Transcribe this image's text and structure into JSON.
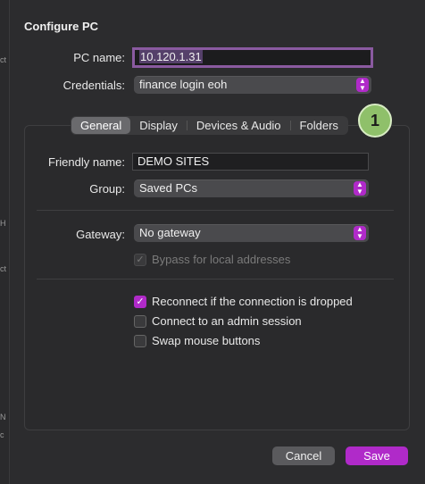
{
  "background": {
    "fragments": [
      "ct",
      "H",
      "ct",
      "N",
      "c"
    ]
  },
  "dialog": {
    "title": "Configure PC",
    "pc_name": {
      "label": "PC name:",
      "value": "10.120.1.31"
    },
    "credentials": {
      "label": "Credentials:",
      "value": "finance login eoh"
    },
    "tabs": [
      "General",
      "Display",
      "Devices & Audio",
      "Folders"
    ],
    "active_tab": "General",
    "badge": "1",
    "general": {
      "friendly_name": {
        "label": "Friendly name:",
        "value": "DEMO SITES"
      },
      "group": {
        "label": "Group:",
        "value": "Saved PCs"
      },
      "gateway": {
        "label": "Gateway:",
        "value": "No gateway"
      },
      "bypass": {
        "label": "Bypass for local addresses",
        "checked": true,
        "enabled": false
      },
      "options": [
        {
          "label": "Reconnect if the connection is dropped",
          "checked": true
        },
        {
          "label": "Connect to an admin session",
          "checked": false
        },
        {
          "label": "Swap mouse buttons",
          "checked": false
        }
      ]
    },
    "buttons": {
      "cancel": "Cancel",
      "save": "Save"
    }
  },
  "colors": {
    "accent": "#b02ac9",
    "badge": "#8fc06a",
    "focus_ring": "#8a5aa0"
  },
  "icons": {
    "chevron": "chevron-up-down-icon",
    "check": "checkmark-icon"
  }
}
